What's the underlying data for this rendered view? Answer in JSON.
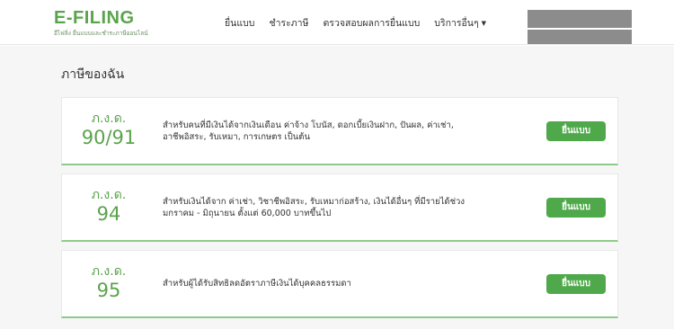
{
  "header": {
    "logo_main": "E-FILING",
    "logo_sub": "อีไฟลิ่ง ยื่นแบบและชำระภาษีออนไลน์",
    "nav": [
      {
        "label": "ยื่นแบบ"
      },
      {
        "label": "ชำระภาษี"
      },
      {
        "label": "ตรวจสอบผลการยื่นแบบ"
      },
      {
        "label": "บริการอื่นๆ"
      }
    ]
  },
  "main": {
    "title": "ภาษีของฉัน",
    "cards": [
      {
        "prefix": "ภ.ง.ด.",
        "code": "90/91",
        "description": "สำหรับคนที่มีเงินได้จากเงินเดือน ค่าจ้าง โบนัส, ดอกเบี้ยเงินฝาก, ปันผล, ค่าเช่า, อาชีพอิสระ, รับเหมา, การเกษตร เป็นต้น",
        "button": "ยื่นแบบ"
      },
      {
        "prefix": "ภ.ง.ด.",
        "code": "94",
        "description": "สำหรับเงินได้จาก ค่าเช่า, วิชาชีพอิสระ, รับเหมาก่อสร้าง, เงินได้อื่นๆ ที่มีรายได้ช่วง มกราคม - มิถุนายน ตั้งแต่ 60,000 บาทขึ้นไป",
        "button": "ยื่นแบบ"
      },
      {
        "prefix": "ภ.ง.ด.",
        "code": "95",
        "description": "สำหรับผู้ได้รับสิทธิลดอัตราภาษีเงินได้บุคคลธรรมดา",
        "button": "ยื่นแบบ"
      }
    ]
  },
  "colors": {
    "brand_green": "#5aa44c",
    "button_green": "#4fa94a",
    "card_border_accent": "#8fc98a",
    "redacted_block": "#8c8c8c"
  }
}
